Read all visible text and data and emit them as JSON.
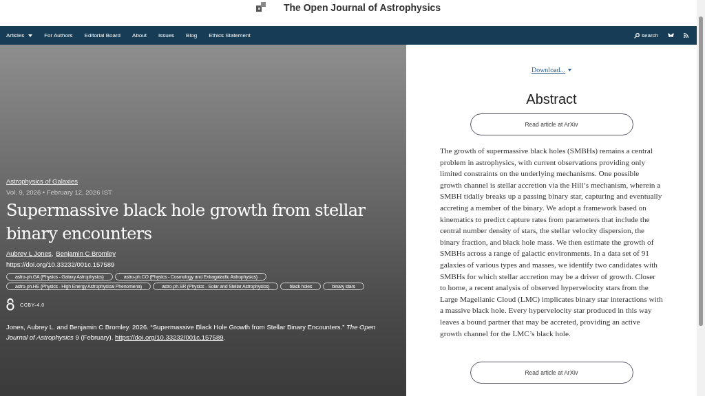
{
  "header": {
    "title": "The Open Journal of Astrophysics"
  },
  "nav": {
    "items": [
      {
        "label": "Articles",
        "dropdown": true
      },
      {
        "label": "For Authors",
        "dropdown": false
      },
      {
        "label": "Editorial Board",
        "dropdown": false
      },
      {
        "label": "About",
        "dropdown": false
      },
      {
        "label": "Issues",
        "dropdown": false
      },
      {
        "label": "Blog",
        "dropdown": false
      },
      {
        "label": "Ethics Statement",
        "dropdown": false
      }
    ],
    "search": "search"
  },
  "article": {
    "section": "Astrophysics of Galaxies",
    "meta": "Vol. 9, 2026 • February 12, 2026 IST",
    "title": "Supermassive black hole growth from stellar binary encounters",
    "authors": [
      "Aubrey L Jones",
      "Benjamin C Bromley"
    ],
    "author_separator": ",",
    "doi": "https://doi.org/10.33232/001c.157589",
    "tags": [
      "astro-ph.GA (Physics - Galaxy Astrophysics)",
      "astro-ph.CO (Physics - Cosmology and Extragalactic Astrophysics)",
      "astro-ph.HE (Physics - High Energy Astrophysical Phenomena)",
      "astro-ph.SR (Physics - Solar and Stellar Astrophysics)",
      "black holes",
      "binary stars"
    ],
    "license": "CCBY-4.0",
    "citation": {
      "text": "Jones, Aubrey L. and Benjamin C Bromley. 2026. “Supermassive Black Hole Growth from Stellar Binary Encounters.” *The Open Journal of Astrophysics* 9 (February). ",
      "link": "https://doi.org/10.33232/001c.157589",
      "end": "."
    }
  },
  "side": {
    "download": "Download...",
    "heading": "Abstract",
    "button_top": "Read article at ArXiv",
    "abstract": "The growth of supermassive black holes (SMBHs) remains a central problem in astrophysics, with current observations providing only limited constraints on the underlying mechanisms. One possible growth channel is stellar accretion via the Hill’s mechanism, wherein a SMBH tidally breaks up a passing binary star, capturing and eventually accreting a member of the binary. We adopt a framework based on kinematics to predict capture rates from parameters that include the central number density of stars, the stellar velocity dispersion, the binary fraction, and black hole mass. We then estimate the growth of SMBHs across a range of galactic environments. In a data set of 91 galaxies of various types and masses, we identify two candidates with SMBHs for which stellar accretion may be a driver of growth. Closer to home, a recent analysis of observed hypervelocity stars from the Large Magellanic Cloud (LMC) implicates binary star interactions with a massive black hole. Every hypervelocity star produced in this way leaves a bound partner that may be accreted, providing an active growth channel for the LMC’s black hole.",
    "button_bottom": "Read article at ArXiv"
  }
}
